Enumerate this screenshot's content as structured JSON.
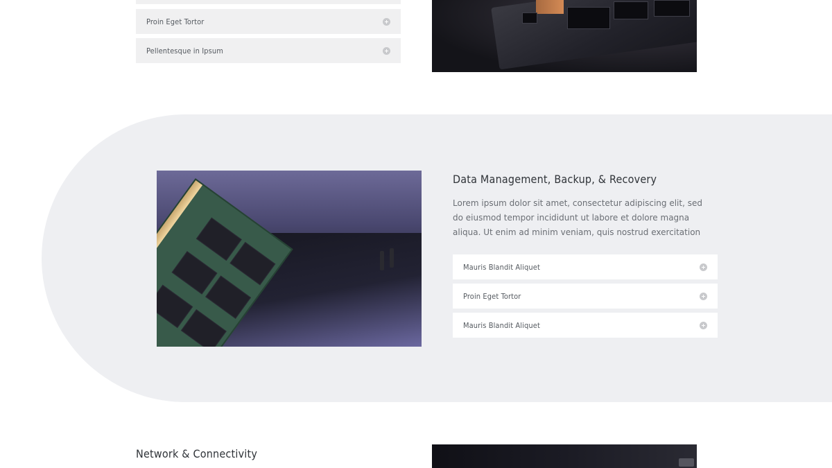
{
  "top_section": {
    "accordion": [
      {
        "label": "Proin Eget Tortor"
      },
      {
        "label": "Pellentesque in Ipsum"
      }
    ]
  },
  "data_section": {
    "title": "Data Management, Backup, & Recovery",
    "description": "Lorem ipsum dolor sit amet, consectetur adipiscing elit, sed do eiusmod tempor incididunt ut labore et dolore magna aliqua. Ut enim ad minim veniam, quis nostrud exercitation",
    "accordion": [
      {
        "label": "Mauris Blandit Aliquet"
      },
      {
        "label": "Proin Eget Tortor"
      },
      {
        "label": "Mauris Blandit Aliquet"
      }
    ]
  },
  "network_section": {
    "title": "Network & Connectivity"
  },
  "colors": {
    "band_background": "#eeeff2",
    "accordion_grey": "#f0f0f1",
    "heading": "#2f3338",
    "body_text": "#6a6e74",
    "plus_icon": "#c8c9cc"
  },
  "icons": {
    "accordion_toggle": "plus-circle-icon"
  }
}
